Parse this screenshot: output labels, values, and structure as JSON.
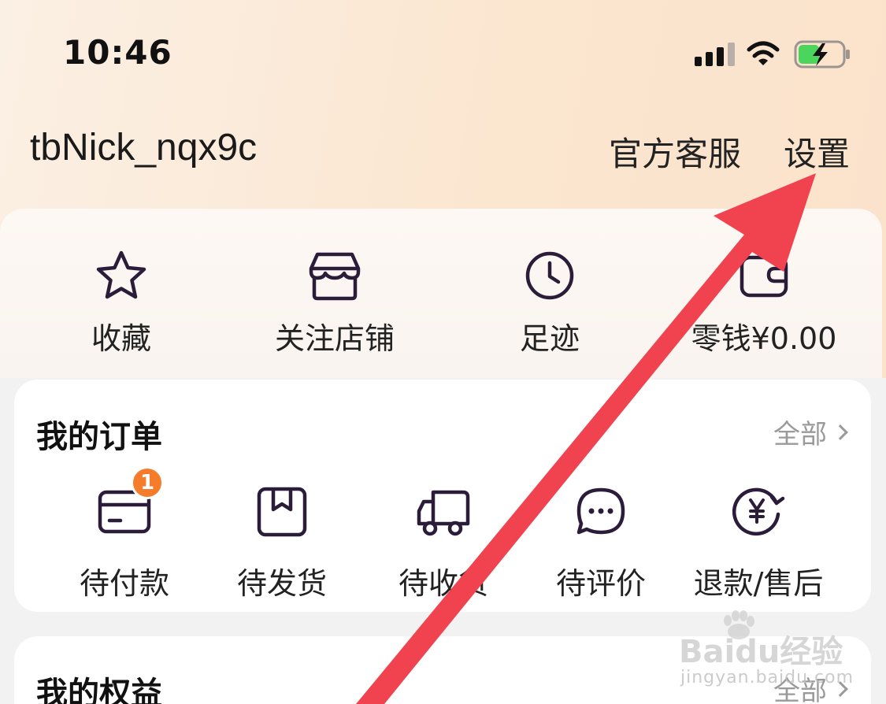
{
  "status_bar": {
    "time": "10:46",
    "icons": [
      "signal-icon",
      "wifi-icon",
      "battery-charging-icon"
    ]
  },
  "header": {
    "nickname": "tbNick_nqx9c",
    "service_label": "官方客服",
    "settings_label": "设置"
  },
  "quick_actions": [
    {
      "label": "收藏",
      "icon": "star-icon"
    },
    {
      "label": "关注店铺",
      "icon": "store-icon"
    },
    {
      "label": "足迹",
      "icon": "clock-icon"
    },
    {
      "label": "零钱¥0.00",
      "icon": "wallet-icon"
    }
  ],
  "orders": {
    "title": "我的订单",
    "more_label": "全部",
    "items": [
      {
        "label": "待付款",
        "icon": "card-payment-icon",
        "badge": "1"
      },
      {
        "label": "待发货",
        "icon": "package-icon"
      },
      {
        "label": "待收货",
        "icon": "truck-icon"
      },
      {
        "label": "待评价",
        "icon": "chat-bubble-icon"
      },
      {
        "label": "退款/售后",
        "icon": "refund-yen-icon"
      }
    ]
  },
  "rights": {
    "title": "我的权益",
    "more_label": "全部"
  },
  "watermark": {
    "text": "Baidu经验",
    "subtext": "jingyan.baidu.com"
  },
  "colors": {
    "arrow": "#f0434f",
    "badge": "#f47c2b",
    "icon_stroke": "#2b1d3a",
    "header_bg": "#fbe6d0"
  }
}
